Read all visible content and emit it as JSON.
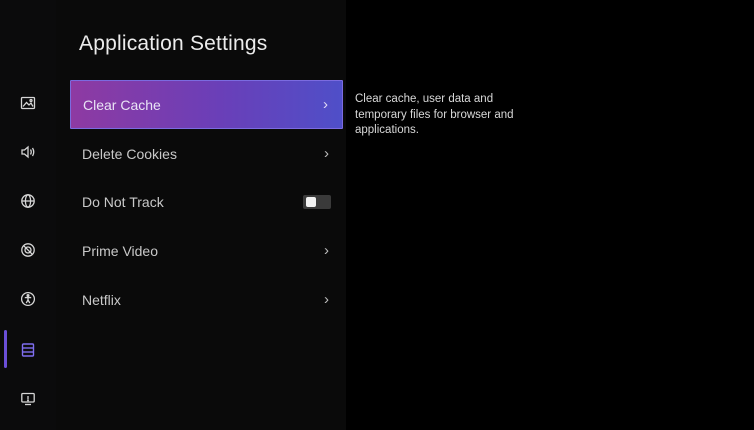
{
  "page": {
    "title": "Application Settings"
  },
  "sidebar": {
    "icons": [
      {
        "name": "picture-icon",
        "active": false
      },
      {
        "name": "sound-icon",
        "active": false
      },
      {
        "name": "network-icon",
        "active": false
      },
      {
        "name": "privacy-icon",
        "active": false
      },
      {
        "name": "accessibility-icon",
        "active": false
      },
      {
        "name": "applications-icon",
        "active": true
      },
      {
        "name": "system-icon",
        "active": false
      }
    ],
    "accent_color": "#6b4fd8"
  },
  "menu": {
    "items": [
      {
        "label": "Clear Cache",
        "control": "chevron",
        "selected": true
      },
      {
        "label": "Delete Cookies",
        "control": "chevron",
        "selected": false
      },
      {
        "label": "Do Not Track",
        "control": "toggle",
        "toggle_on": false,
        "selected": false
      },
      {
        "label": "Prime Video",
        "control": "chevron",
        "selected": false
      },
      {
        "label": "Netflix",
        "control": "chevron",
        "selected": false
      }
    ],
    "chevron_glyph": "›",
    "selected_gradient": [
      "#8e3aa2",
      "#4f4fc8"
    ]
  },
  "description": {
    "text": "Clear cache, user data and temporary files for browser and applications."
  }
}
